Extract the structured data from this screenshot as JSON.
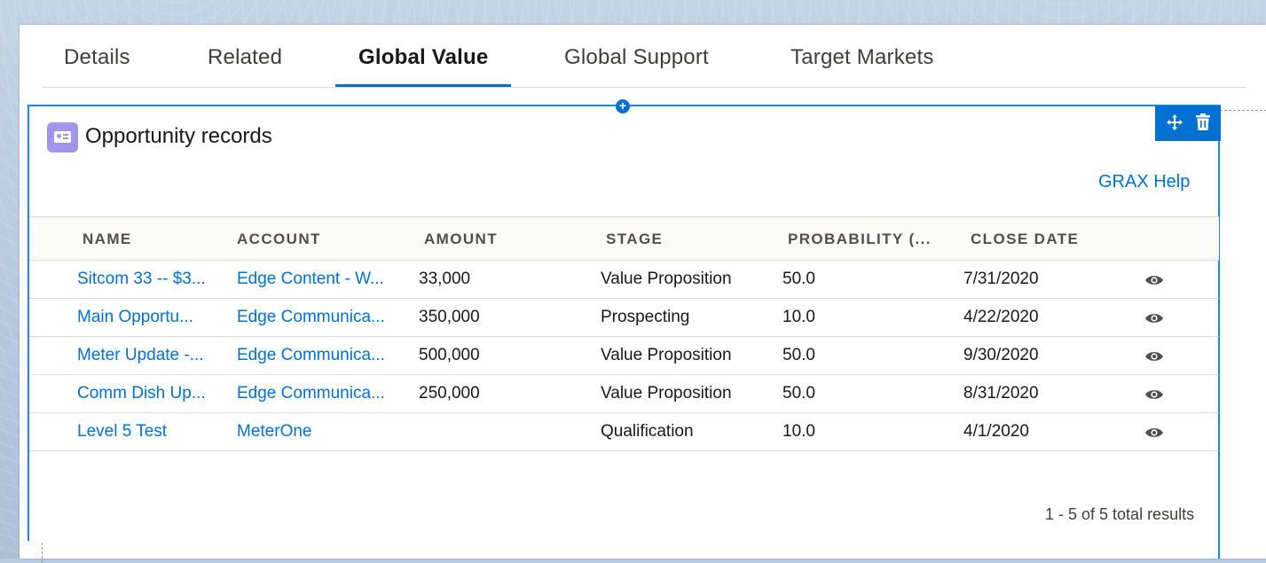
{
  "tabs": [
    {
      "label": "Details",
      "active": false
    },
    {
      "label": "Related",
      "active": false
    },
    {
      "label": "Global Value",
      "active": true
    },
    {
      "label": "Global Support",
      "active": false
    },
    {
      "label": "Target Markets",
      "active": false
    }
  ],
  "card": {
    "title": "Opportunity records",
    "icon": "id-card-icon",
    "help_link": "GRAX Help",
    "toolbar": {
      "move_icon": "move-icon",
      "delete_icon": "trash-icon"
    }
  },
  "table": {
    "columns": [
      "NAME",
      "ACCOUNT",
      "AMOUNT",
      "STAGE",
      "PROBABILITY (...",
      "CLOSE DATE"
    ],
    "rows": [
      {
        "name": "Sitcom 33 -- $3...",
        "account": "Edge Content - W...",
        "amount": "33,000",
        "stage": "Value Proposition",
        "probability": "50.0",
        "close_date": "7/31/2020"
      },
      {
        "name": "Main Opportu...",
        "account": "Edge Communica...",
        "amount": "350,000",
        "stage": "Prospecting",
        "probability": "10.0",
        "close_date": "4/22/2020"
      },
      {
        "name": "Meter Update -...",
        "account": "Edge Communica...",
        "amount": "500,000",
        "stage": "Value Proposition",
        "probability": "50.0",
        "close_date": "9/30/2020"
      },
      {
        "name": "Comm Dish Up...",
        "account": "Edge Communica...",
        "amount": "250,000",
        "stage": "Value Proposition",
        "probability": "50.0",
        "close_date": "8/31/2020"
      },
      {
        "name": "Level 5 Test",
        "account": "MeterOne",
        "amount": "",
        "stage": "Qualification",
        "probability": "10.0",
        "close_date": "4/1/2020"
      }
    ],
    "results_text": "1 - 5 of 5 total results"
  },
  "colors": {
    "accent": "#0070d2",
    "card_border": "#1589ee",
    "icon_bg": "#a094ed"
  }
}
